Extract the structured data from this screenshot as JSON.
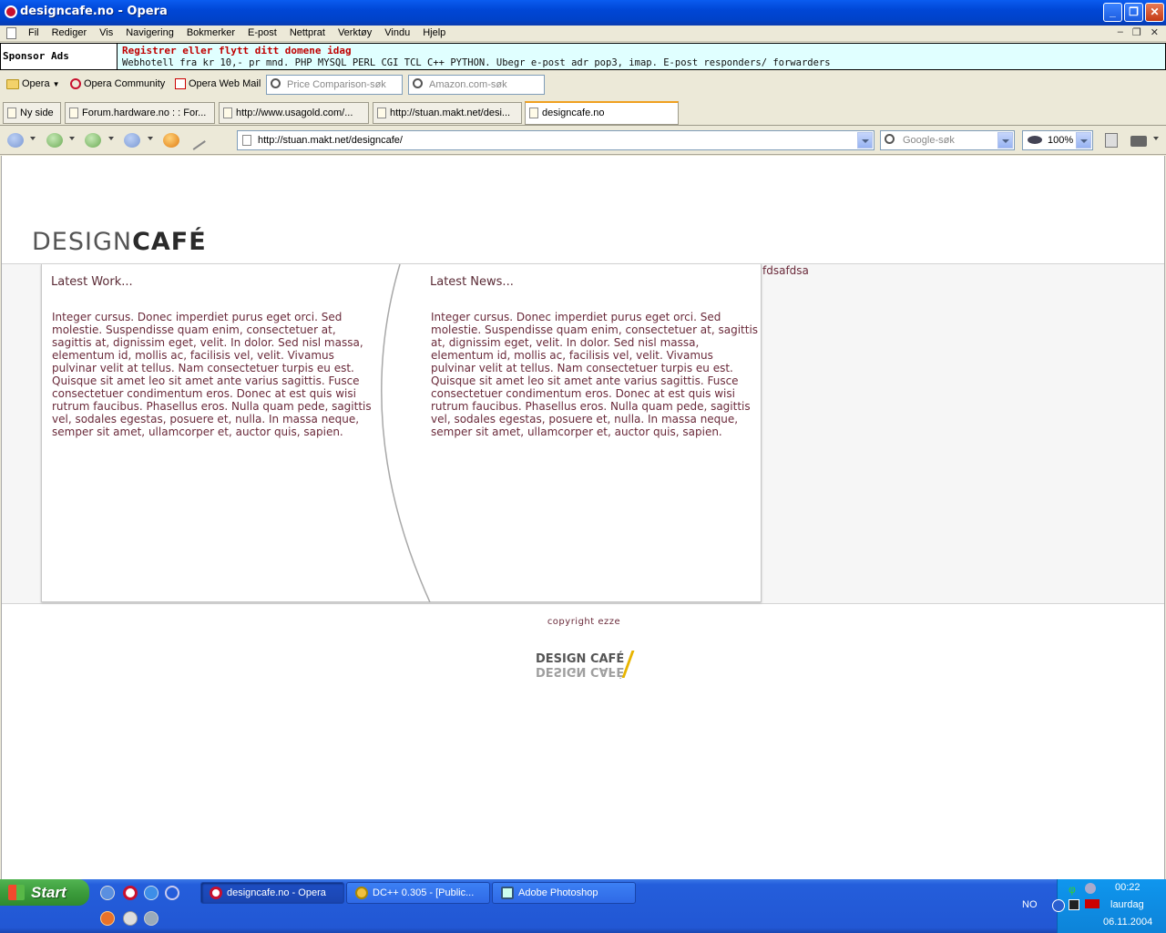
{
  "window": {
    "title": "designcafe.no - Opera",
    "controls": [
      "_",
      "❐",
      "✕"
    ]
  },
  "menu": {
    "items": [
      "Fil",
      "Rediger",
      "Vis",
      "Navigering",
      "Bokmerker",
      "E-post",
      "Nettprat",
      "Verktøy",
      "Vindu",
      "Hjelp"
    ],
    "mdi": [
      "–",
      "❐",
      "✕"
    ]
  },
  "sponsor": {
    "label": "Sponsor Ads",
    "headline": "Registrer eller flytt ditt domene idag",
    "text": "Webhotell fra kr 10,- pr mnd. PHP MYSQL PERL CGI TCL C++ PYTHON. Ubegr e-post adr pop3, imap. E-post responders/ forwarders"
  },
  "personal_bar": {
    "opera": "Opera",
    "community": "Opera Community",
    "webmail": "Opera Web Mail",
    "price_placeholder": "Price Comparison-søk",
    "amazon_placeholder": "Amazon.com-søk"
  },
  "tabs": [
    {
      "label": "Ny side"
    },
    {
      "label": "Forum.hardware.no : : For..."
    },
    {
      "label": "http://www.usagold.com/..."
    },
    {
      "label": "http://stuan.makt.net/desi..."
    },
    {
      "label": "designcafe.no"
    }
  ],
  "nav": {
    "url": "http://stuan.makt.net/designcafe/",
    "search_placeholder": "Google-søk",
    "zoom": "100%"
  },
  "page": {
    "logo_part1": "DESIGN",
    "logo_part2": "CAFÉ",
    "latest_work_heading": "Latest Work...",
    "latest_work_text": "Integer cursus. Donec imperdiet purus eget orci. Sed molestie. Suspendisse quam enim, consectetuer at, sagittis at, dignissim eget, velit. In dolor. Sed nisl massa, elementum id, mollis ac, facilisis vel, velit. Vivamus pulvinar velit at tellus. Nam consectetuer turpis eu est. Quisque sit amet leo sit amet ante varius sagittis. Fusce consectetuer condimentum eros. Donec at est quis wisi rutrum faucibus. Phasellus eros. Nulla quam pede, sagittis vel, sodales egestas, posuere et, nulla. In massa neque, semper sit amet, ullamcorper et, auctor quis, sapien.",
    "latest_news_heading": "Latest News...",
    "latest_news_text": "Integer cursus. Donec imperdiet purus eget orci. Sed molestie. Suspendisse quam enim, consectetuer at, sagittis at, dignissim eget, velit. In dolor. Sed nisl massa, elementum id, mollis ac, facilisis vel, velit. Vivamus pulvinar velit at tellus. Nam consectetuer turpis eu est. Quisque sit amet leo sit amet ante varius sagittis. Fusce consectetuer condimentum eros. Donec at est quis wisi rutrum faucibus. Phasellus eros. Nulla quam pede, sagittis vel, sodales egestas, posuere et, nulla. In massa neque, semper sit amet, ullamcorper et, auctor quis, sapien.",
    "side_text": "fdsafdsa",
    "copyright": "copyright ezze",
    "footer_logo": "DESIGN CAFÉ"
  },
  "taskbar": {
    "start": "Start",
    "tasks": [
      {
        "label": "designcafe.no - Opera"
      },
      {
        "label": "DC++ 0.305 - [Public..."
      },
      {
        "label": "Adobe Photoshop"
      }
    ],
    "lang": "NO",
    "time": "00:22",
    "day": "laurdag",
    "date": "06.11.2004"
  },
  "colors": {
    "text_accent": "#6a2a3a",
    "sponsor_bg": "#e0ffff",
    "sponsor_headline": "#c00000"
  }
}
